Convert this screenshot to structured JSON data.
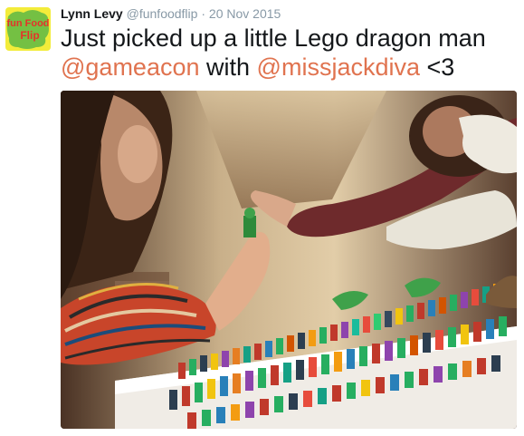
{
  "author": {
    "name": "Lynn Levy",
    "handle": "@funfoodflip",
    "separator": "·",
    "date": "20 Nov 2015",
    "avatar_text_top": "fun Food",
    "avatar_text_bottom": "Flip"
  },
  "tweet": {
    "line1": "Just picked up a little Lego dragon man",
    "mention1": "@gameacon",
    "mid_text": "with",
    "mention2": "@missjackdiva",
    "end_text": "<3"
  },
  "colors": {
    "mention": "#e0734f",
    "meta": "#8899a6",
    "text": "#14171a"
  },
  "media": {
    "icon": "photo-of-lego-minifigure-display"
  }
}
